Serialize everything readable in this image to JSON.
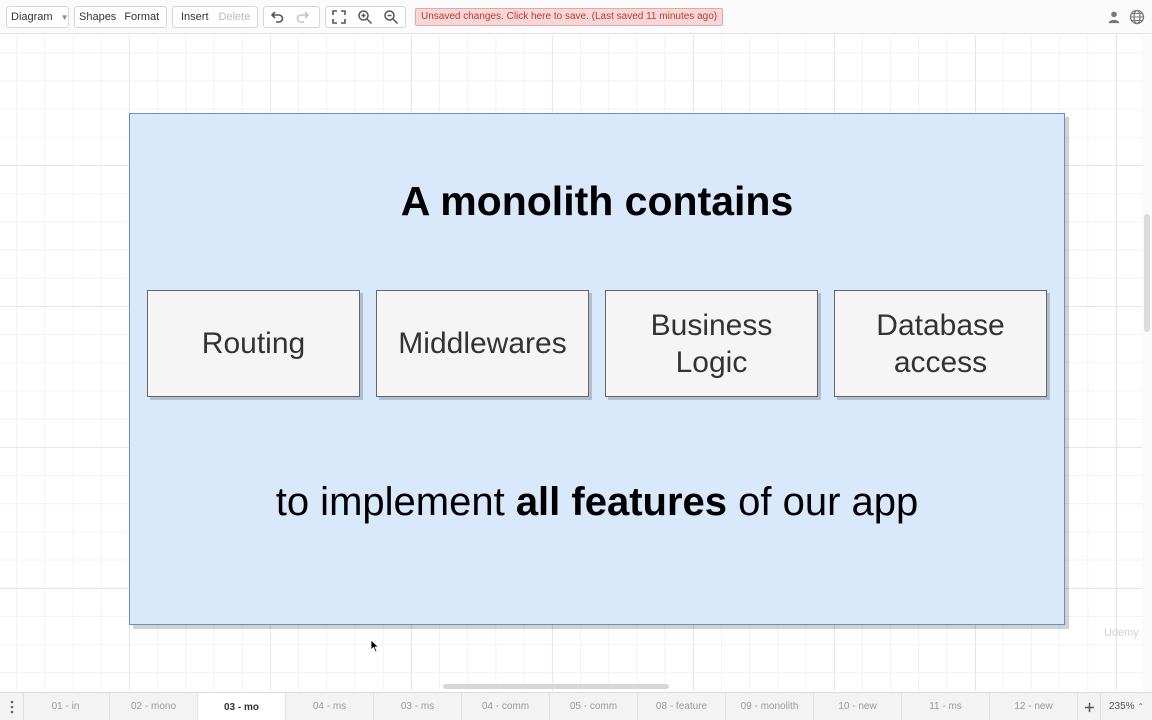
{
  "toolbar": {
    "diagram": "Diagram",
    "shapes": "Shapes",
    "format": "Format",
    "insert": "Insert",
    "delete": "Delete",
    "unsaved": "Unsaved changes. Click here to save. (Last saved 11 minutes ago)"
  },
  "icons": [
    "undo-icon",
    "redo-icon",
    "fullscreen-icon",
    "zoom-in-icon",
    "zoom-out-icon",
    "user-icon",
    "globe-icon",
    "add-icon",
    "chevron-up-icon",
    "menu-dots-icon"
  ],
  "diagram": {
    "title": "A monolith contains",
    "components": [
      {
        "line1": "Routing",
        "line2": ""
      },
      {
        "line1": "Middlewares",
        "line2": ""
      },
      {
        "line1": "Business",
        "line2": "Logic"
      },
      {
        "line1": "Database",
        "line2": "access"
      }
    ],
    "subtitle_pre": "to implement ",
    "subtitle_bold": "all features",
    "subtitle_post": " of our app",
    "watermark": "Udemy"
  },
  "tabs": [
    {
      "label": "01 - in"
    },
    {
      "label": "02 - mono"
    },
    {
      "label": "03 - mo"
    },
    {
      "label": "04 - ms"
    },
    {
      "label": "03 - ms"
    },
    {
      "label": "04 - comm"
    },
    {
      "label": "05 - comm"
    },
    {
      "label": "08 - feature"
    },
    {
      "label": "09 - monolith"
    },
    {
      "label": "10 - new"
    },
    {
      "label": "11 - ms"
    },
    {
      "label": "12 - new"
    }
  ],
  "active_tab": "03 - mo",
  "zoom": "235%",
  "colors": {
    "container_fill": "#dae8fc",
    "container_stroke": "#6c8ebf",
    "component_fill": "#f5f5f5",
    "component_stroke": "#666666",
    "unsaved_bg": "#f6d8d8",
    "unsaved_text": "#c0392b"
  }
}
